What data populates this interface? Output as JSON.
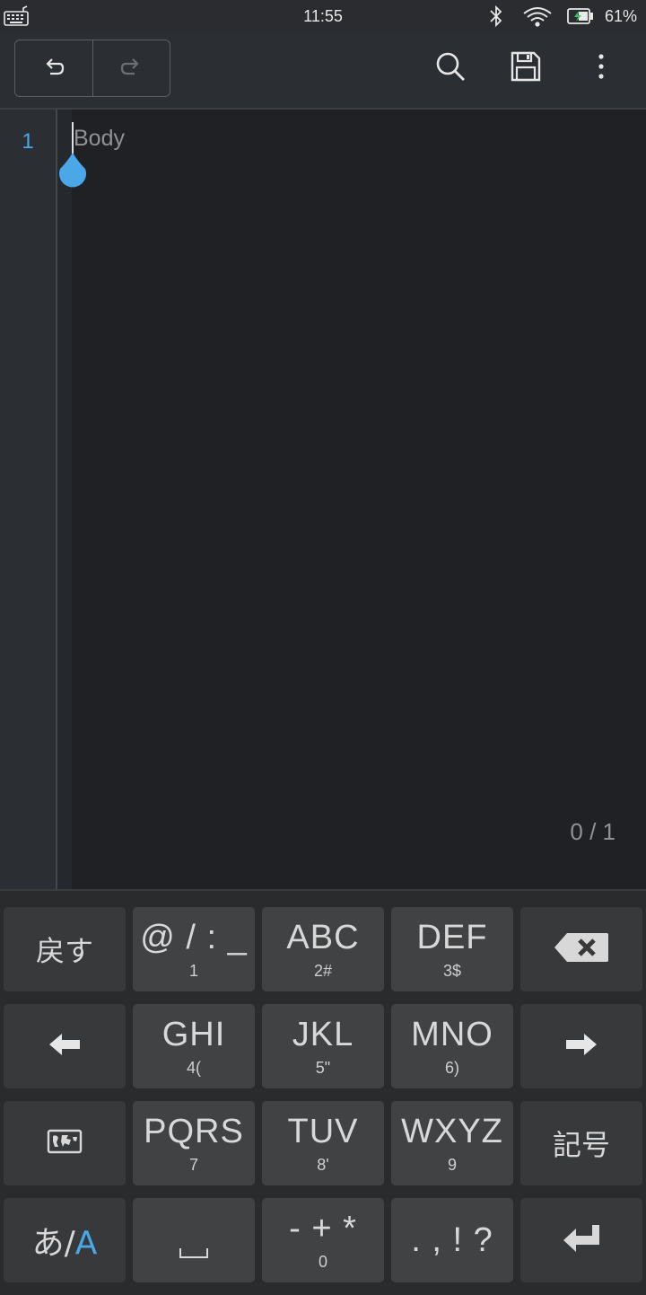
{
  "status_bar": {
    "time": "11:55",
    "battery_percent": "61%",
    "icons": [
      "keyboard-icon",
      "bluetooth-icon",
      "wifi-icon",
      "battery-charging-icon"
    ]
  },
  "toolbar": {
    "undo_icon": "undo-icon",
    "redo_icon": "redo-icon",
    "search_icon": "search-icon",
    "save_icon": "save-icon",
    "menu_icon": "more-vert-icon"
  },
  "editor": {
    "line_number": "1",
    "placeholder": "Body",
    "line_counter": "0 / 1"
  },
  "keyboard": {
    "rows": [
      [
        {
          "main": "戻す",
          "sub": ""
        },
        {
          "main": "@ / : _",
          "sub": "1"
        },
        {
          "main": "ABC",
          "sub": "2#"
        },
        {
          "main": "DEF",
          "sub": "3$"
        },
        {
          "icon": "backspace-icon"
        }
      ],
      [
        {
          "icon": "arrow-left-icon"
        },
        {
          "main": "GHI",
          "sub": "4("
        },
        {
          "main": "JKL",
          "sub": "5\""
        },
        {
          "main": "MNO",
          "sub": "6)"
        },
        {
          "icon": "arrow-right-icon"
        }
      ],
      [
        {
          "icon": "globe-map-icon"
        },
        {
          "main": "PQRS",
          "sub": "7"
        },
        {
          "main": "TUV",
          "sub": "8'"
        },
        {
          "main": "WXYZ",
          "sub": "9"
        },
        {
          "main": "記号",
          "sub": ""
        }
      ],
      [
        {
          "main_a": "あ/",
          "main_b": "A"
        },
        {
          "icon": "space-icon"
        },
        {
          "main": "- + *",
          "sub": "0"
        },
        {
          "main": ". , ! ?",
          "sub": ""
        },
        {
          "icon": "enter-icon"
        }
      ]
    ],
    "accent_color": "#4aa8e8"
  }
}
